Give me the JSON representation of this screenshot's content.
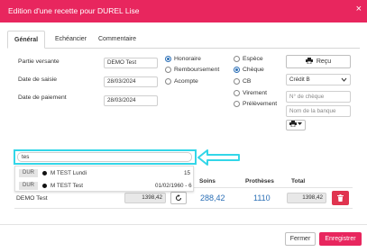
{
  "window": {
    "title": "Edition d'une recette pour DUREL Lise",
    "close_glyph": "×"
  },
  "tabs": [
    {
      "label": "Général",
      "active": true
    },
    {
      "label": "Echéancier",
      "active": false
    },
    {
      "label": "Commentaire",
      "active": false
    }
  ],
  "form": {
    "partie_versante": {
      "label": "Partie versante",
      "value": "DEMO Test"
    },
    "date_saisie": {
      "label": "Date de saisie",
      "value": "28/03/2024"
    },
    "date_paiement": {
      "label": "Date de paiement",
      "value": "28/03/2024"
    }
  },
  "type_options": [
    {
      "label": "Honoraire",
      "selected": true
    },
    {
      "label": "Remboursement",
      "selected": false
    },
    {
      "label": "Acompte",
      "selected": false
    }
  ],
  "payment_options": [
    {
      "label": "Espèce",
      "selected": false
    },
    {
      "label": "Chèque",
      "selected": true
    },
    {
      "label": "CB",
      "selected": false
    },
    {
      "label": "Virement",
      "selected": false
    },
    {
      "label": "Prélèvement",
      "selected": false
    }
  ],
  "right_panel": {
    "recu_label": "Reçu",
    "recu_icon": "printer-icon",
    "bank_select": "Crédit B",
    "cheque_placeholder": "N° de chèque",
    "bank_name_placeholder": "Nom de la banque",
    "print_dropdown_icon": "printer-icon"
  },
  "search": {
    "value": "tes"
  },
  "dropdown_items": [
    {
      "tag": "DUR",
      "name": "M TEST Lundi",
      "extra": "15"
    },
    {
      "tag": "DUR",
      "name": "M TEST Test",
      "extra": "01/02/1960 - 6"
    }
  ],
  "table": {
    "headers": {
      "soins": "Soins",
      "protheses": "Prothèses",
      "total": "Total"
    },
    "row": {
      "name": "DEMO Test",
      "amount": "1398,42",
      "soins": "288,42",
      "protheses": "1110",
      "total": "1398,42"
    }
  },
  "footer": {
    "close_label": "Fermer",
    "save_label": "Enregistrer"
  },
  "colors": {
    "header": "#e8265e",
    "accent_blue": "#2b6fb6",
    "highlight": "#33d6e8",
    "delete": "#e0344f"
  }
}
